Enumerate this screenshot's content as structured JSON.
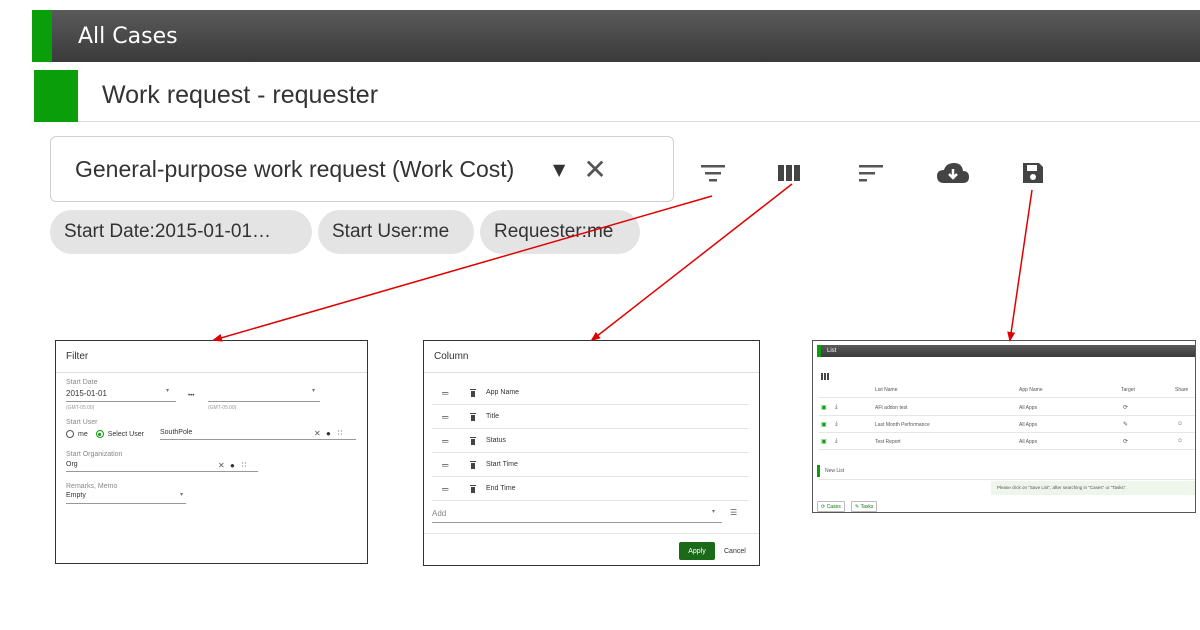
{
  "main": {
    "header_title": "All Cases",
    "subheader_title": "Work request - requester",
    "selector_text": "General-purpose work request (Work Cost)",
    "icons": [
      "filter-icon",
      "column-icon",
      "sort-icon",
      "cloud-download-icon",
      "save-icon"
    ],
    "chips": [
      "Start Date:2015-01-01…",
      "Start User:me",
      "Requester:me"
    ]
  },
  "filter": {
    "title": "Filter",
    "start_date_label": "Start Date",
    "start_date_value": "2015-01-01",
    "range_sep": "•••",
    "tz_from": "(GMT-05:00)",
    "tz_to": "(GMT-05:00)",
    "start_user_label": "Start User",
    "radio_me": "me",
    "radio_select_user": "Select User",
    "select_user_value": "SouthPole",
    "start_org_label": "Start Organization",
    "start_org_value": "Org",
    "remarks_label": "Remarks, Memo",
    "remarks_value": "Empty"
  },
  "column": {
    "title": "Column",
    "rows": [
      "App Name",
      "Title",
      "Status",
      "Start Time",
      "End Time"
    ],
    "add_placeholder": "Add",
    "apply_label": "Apply",
    "cancel_label": "Cancel"
  },
  "list": {
    "header": "List",
    "col_list_name": "List Name",
    "col_app_name": "App Name",
    "col_target": "Target",
    "col_share": "Share",
    "rows": [
      {
        "name": "AFt addon test",
        "app": "All Apps"
      },
      {
        "name": "Last Month Performance",
        "app": "All Apps"
      },
      {
        "name": "Test Report",
        "app": "All Apps"
      }
    ],
    "new_list": "New List",
    "hint": "Please click on \"Save List\", after searching in \"Cases\" or \"Tasks\".",
    "cases_btn": "Cases",
    "tasks_btn": "Tasks"
  },
  "colors": {
    "accent_green": "#0a9e0a",
    "arrow_red": "#e00000",
    "apply_green": "#1a6a1a"
  }
}
